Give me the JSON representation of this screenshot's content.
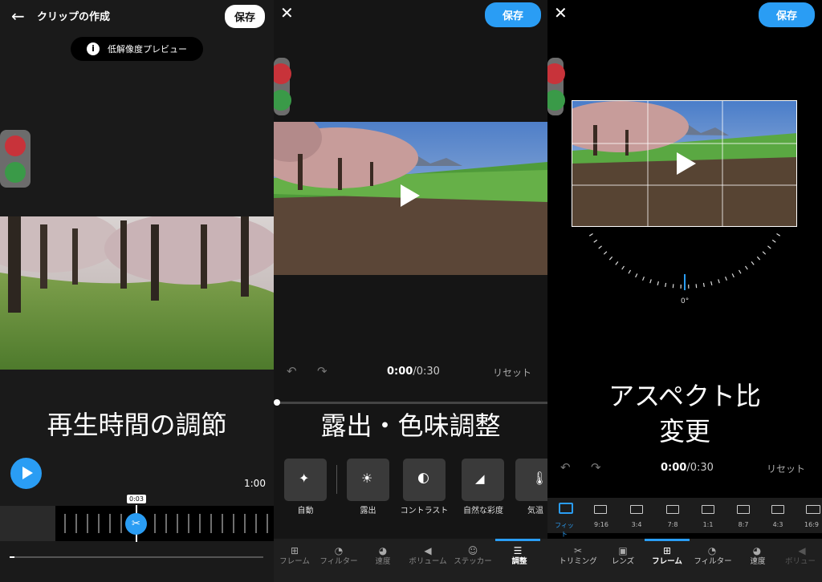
{
  "panel1": {
    "title": "クリップの作成",
    "save_label": "保存",
    "preview_badge": "低解像度プレビュー",
    "caption": "再生時間の調節",
    "duration_end": "1:00",
    "trim_marker": "0:03",
    "playback_progress": 0.02
  },
  "panel2": {
    "save_label": "保存",
    "time_current": "0:00",
    "time_total": "/0:30",
    "reset_label": "リセット",
    "caption": "露出・色味調整",
    "tools": [
      {
        "label": "自動",
        "icon": "magic-wand-icon"
      },
      {
        "label": "露出",
        "icon": "sun-icon"
      },
      {
        "label": "コントラスト",
        "icon": "contrast-icon"
      },
      {
        "label": "自然な彩度",
        "icon": "vibrance-icon"
      },
      {
        "label": "気温",
        "icon": "thermometer-icon"
      }
    ],
    "tabs": [
      "フレーム",
      "フィルター",
      "速度",
      "ボリューム",
      "ステッカー",
      "調整"
    ],
    "active_tab": "調整"
  },
  "panel3": {
    "save_label": "保存",
    "angle": "0°",
    "caption_line1": "アスペクト比",
    "caption_line2": "変更",
    "time_current": "0:00",
    "time_total": "/0:30",
    "reset_label": "リセット",
    "ratios": [
      "フィット",
      "9:16",
      "3:4",
      "7:8",
      "1:1",
      "8:7",
      "4:3",
      "16:9"
    ],
    "active_ratio": "フィット",
    "tabs": [
      "トリミング",
      "レンズ",
      "フレーム",
      "フィルター",
      "速度",
      "ボリュー"
    ],
    "active_tab": "フレーム"
  },
  "colors": {
    "accent": "#2a9df4",
    "panel_bg": "#1a1a1a"
  }
}
